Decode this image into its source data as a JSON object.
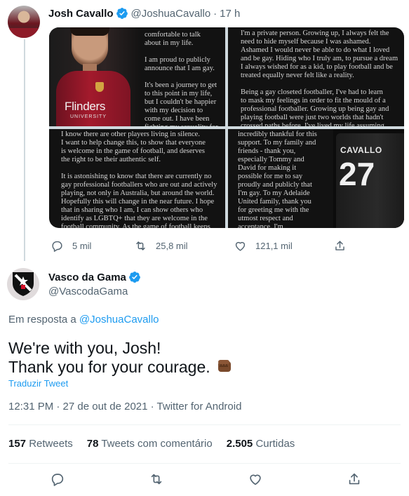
{
  "tweet1": {
    "name": "Josh Cavallo",
    "handle": "@JoshuaCavallo",
    "separator": "·",
    "time": "17 h",
    "images": {
      "tile1_text": "comfortable to talk\nabout in my life.\n\nI am proud to publicly\nannounce that I am gay.\n\nIt's been a journey to get\nto this point in my life,\nbut I couldn't be happier\nwith my decision to\ncome out. I have been\nfighting my sexuality for",
      "tile1_sponsor": "Flinders",
      "tile1_sponsor_sub": "UNIVERSITY",
      "tile2_text": "I'm a private person. Growing up, I always felt the\nneed to hide myself because I was ashamed.\nAshamed I would never be able to do what I loved\nand be gay. Hiding who I truly am, to pursue a dream\nI always wished for as a kid, to play football and be\ntreated equally never felt like a reality.\n\nBeing a gay closeted footballer, I've had to learn\nto mask my feelings in order to fit the mould of a\nprofessional footballer. Growing up being gay and\nplaying football were just two worlds that hadn't\ncrossed paths before. I've lived my life assuming",
      "tile3_text": "I know there are other players living in silence.\nI want to help change this, to show that everyone\nis welcome in the game of football, and deserves\nthe right to be their authentic self.\n\nIt is astonishing to know that there are currently no\ngay professional footballers who are out and actively\nplaying, not only in Australia, but around the world.\nHopefully this will change in the near future. I hope\nthat in sharing who I am, I can show others who\nidentify as LGBTQ+ that they are welcome in the\nfootball community. As the game of football keeps",
      "tile4_text": "incredibly thankful for this\nsupport. To my family and\nfriends - thank you,\nespecially Tommy and\nDavid for making it\npossible for me to say\nproudly and publicly that\nI'm gay. To my Adelaide\nUnited family, thank you\nfor greeting me with the\nutmost respect and\nacceptance. I'm",
      "jersey_name": "CAVALLO",
      "jersey_number": "27"
    },
    "actions": {
      "replies": "5 mil",
      "retweets": "25,8 mil",
      "likes": "121,1 mil"
    }
  },
  "tweet2": {
    "name": "Vasco da Gama",
    "handle": "@VascodaGama",
    "reply_prefix": "Em resposta a",
    "reply_mention": "@JoshuaCavallo",
    "text": "We're with you, Josh!\nThank you for your courage.",
    "translate_label": "Traduzir Tweet",
    "meta": "12:31 PM · 27 de out de 2021 · Twitter for Android",
    "stats": {
      "retweets_count": "157",
      "retweets_label": "Retweets",
      "quotes_count": "78",
      "quotes_label": "Tweets com comentário",
      "likes_count": "2.505",
      "likes_label": "Curtidas"
    }
  },
  "colors": {
    "accent": "#1d9bf0",
    "muted": "#536471",
    "text": "#0f1419",
    "divider": "#eff3f4"
  },
  "icons": [
    "verified-badge-icon",
    "reply-icon",
    "retweet-icon",
    "like-icon",
    "share-icon",
    "fist-emoji-icon"
  ]
}
